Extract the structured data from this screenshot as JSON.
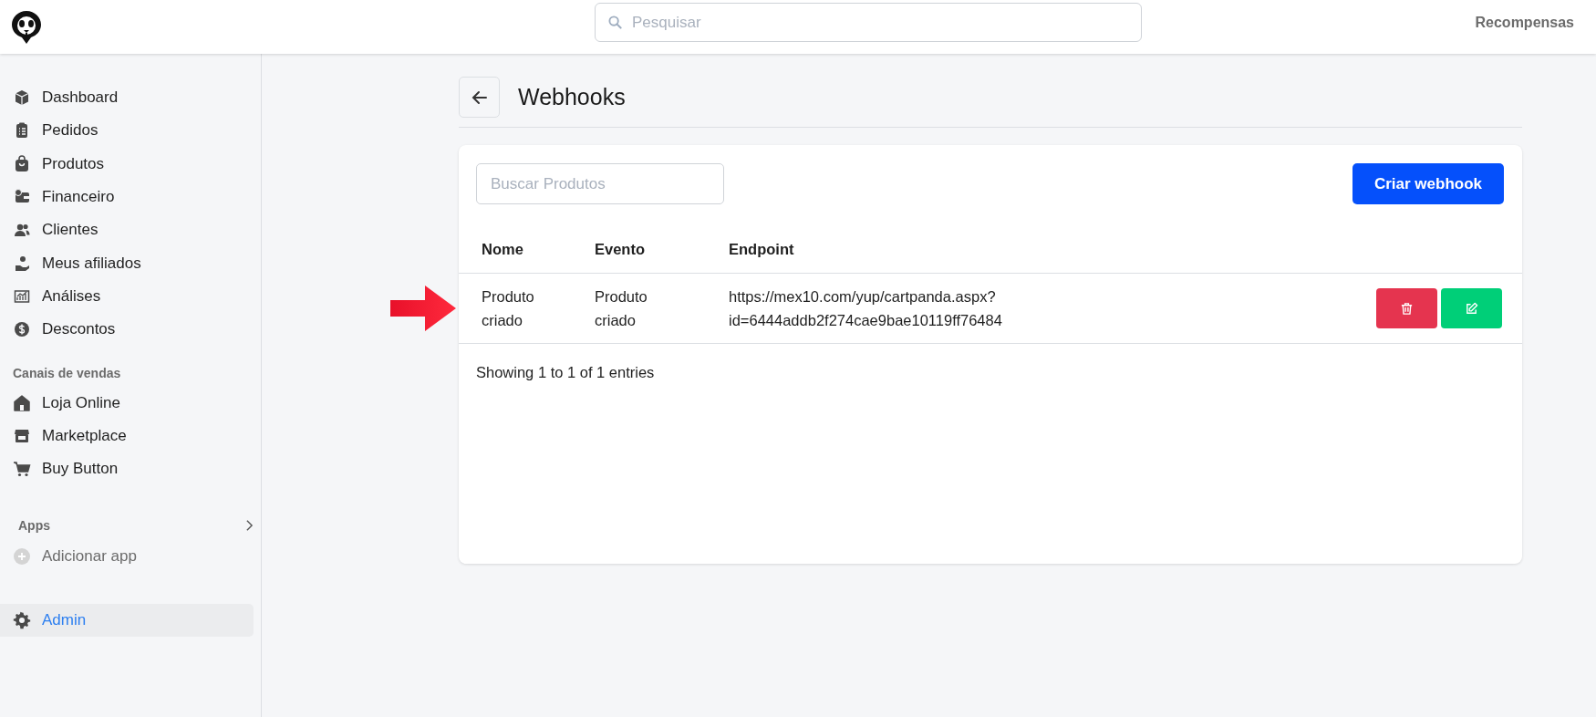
{
  "header": {
    "search": {
      "placeholder": "Pesquisar"
    },
    "rewards_link": "Recompensas"
  },
  "sidebar": {
    "main_items": [
      {
        "label": "Dashboard",
        "selected": false
      },
      {
        "label": "Pedidos",
        "selected": false
      },
      {
        "label": "Produtos",
        "selected": false
      },
      {
        "label": "Financeiro",
        "selected": false
      },
      {
        "label": "Clientes",
        "selected": false
      },
      {
        "label": "Meus afiliados",
        "selected": false
      },
      {
        "label": "Análises",
        "selected": false
      },
      {
        "label": "Descontos",
        "selected": false
      }
    ],
    "sales_channels": {
      "heading": "Canais de vendas",
      "items": [
        {
          "label": "Loja Online",
          "selected": false
        },
        {
          "label": "Marketplace",
          "selected": false
        },
        {
          "label": "Buy Button",
          "selected": false
        }
      ]
    },
    "apps": {
      "heading": "Apps",
      "add_item": "Adicionar app"
    },
    "admin": {
      "label": "Admin",
      "selected": true
    }
  },
  "page": {
    "title": "Webhooks",
    "search": {
      "placeholder": "Buscar Produtos"
    },
    "create_button": "Criar webhook",
    "table": {
      "columns": [
        "Nome",
        "Evento",
        "Endpoint"
      ],
      "rows": [
        {
          "name": "Produto criado",
          "event": "Produto criado",
          "endpoint": "https://mex10.com/yup/cartpanda.aspx?id=6444addb2f274cae9bae10119ff76484",
          "highlighted": true
        }
      ]
    },
    "footer": "Showing 1 to 1 of 1 entries"
  }
}
